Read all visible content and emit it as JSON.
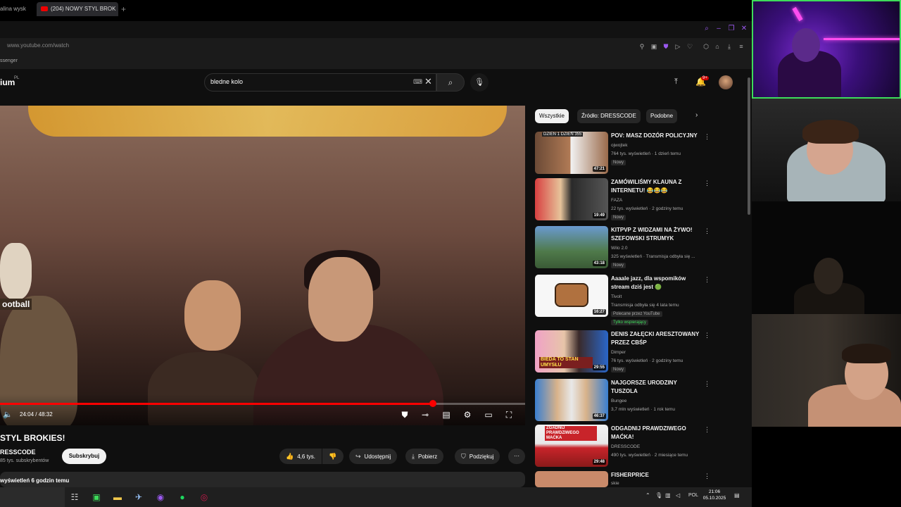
{
  "browser": {
    "tabs": [
      {
        "label": "alina wysk"
      },
      {
        "label": "(204) NOWY STYL BROK"
      }
    ],
    "new_tab_label": "+",
    "url": "www.youtube.com/watch",
    "bookmark": "ssenger"
  },
  "youtube": {
    "logo_text": "ium",
    "logo_sup": "PL",
    "search_value": "bledne kolo",
    "notification_count": "9+",
    "video": {
      "time": "24:04 / 48:32",
      "progress_fraction": 0.825,
      "overlay_text": "ootball"
    },
    "title": "STYL BROKIES!",
    "channel": "RESSCODE",
    "subscribers": "85 tys. subskrybentów",
    "subscribe_label": "Subskrybuj",
    "like_count": "4,6 tys.",
    "share_label": "Udostępnij",
    "download_label": "Pobierz",
    "thanks_label": "Podziękuj",
    "description": "wyświetleń  6 godzin temu",
    "chips": [
      "Wszystkie",
      "Źródło: DRESSCODE",
      "Podobne"
    ],
    "recommendations": [
      {
        "title": "POV: MASZ DOZÓR POLICYJNY",
        "channel": "ojwojtek",
        "meta": "764 tys. wyświetleń · 1 dzień temu",
        "badge": "Nowy",
        "duration": "47:21",
        "thumb_overlay": "DZIEŃ 1   DZIEŃ 355"
      },
      {
        "title": "ZAMÓWILIŚMY KLAUNA Z INTERNETU! 😂😂😂",
        "channel": "FAZA",
        "meta": "22 tys. wyświetleń · 2 godziny temu",
        "badge": "Nowy",
        "duration": "19:49"
      },
      {
        "title": "KITPVP Z WIDZAMI NA ŻYWO! SZEFOWSKI STRUMYK",
        "channel": "Wilo 2.0",
        "meta": "325 wyświetleń · Transmisja odbyła się ...",
        "badge": "Nowy",
        "duration": "43:18"
      },
      {
        "title": "Aaaale jazz, dla wspomików stream dziś jest 🟢",
        "channel": "Tivolt",
        "meta": "Transmisja odbyła się 4 lata temu",
        "badge": "Polecane przez YouTube",
        "badge2": "Tylko wspierający",
        "duration": "16:27"
      },
      {
        "title": "DENIS ZAŁĘCKI ARESZTOWANY PRZEZ CBŚP",
        "channel": "Dimper",
        "meta": "76 tys. wyświetleń · 2 godziny temu",
        "badge": "Nowy",
        "duration": "29:55",
        "thumb_overlay": "BIEDA TO STAN UMYSŁU"
      },
      {
        "title": "NAJGORSZE URODZINY TUSZOLA",
        "channel": "Bungee",
        "meta": "3,7 mln wyświetleń · 1 rok temu",
        "duration": "46:37"
      },
      {
        "title": "ODGADNIJ PRAWDZIWEGO MAĆKA!",
        "channel": "DRESSCODE",
        "meta": "490 tys. wyświetleń · 2 miesiące temu",
        "duration": "29:48",
        "thumb_overlay": "ZGADNIJ PRAWDZIWEGO MAĆKA"
      },
      {
        "title": "FISHERPRICE",
        "channel": "skie"
      }
    ]
  },
  "taskbar": {
    "time": "21:06",
    "date": "05.10.2025",
    "lang": "POL"
  },
  "colors": {
    "accent": "#ff0000",
    "page_bg": "#0f0f0f",
    "cam_border": "#3ddc5a"
  }
}
